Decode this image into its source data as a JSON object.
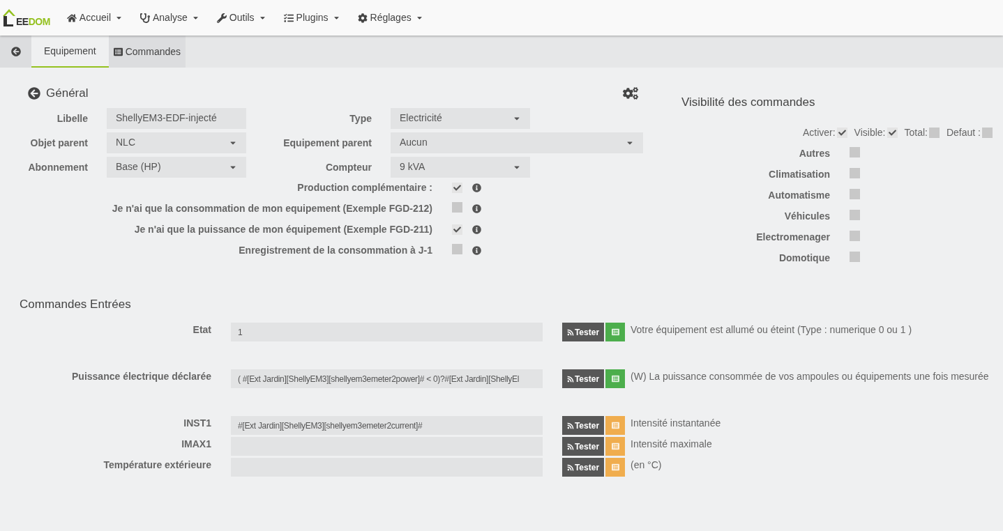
{
  "navbar": {
    "logo_text": "EEDOM",
    "menus": [
      {
        "kind": "home",
        "label": "Accueil"
      },
      {
        "kind": "analysis",
        "label": "Analyse"
      },
      {
        "kind": "tools",
        "label": "Outils"
      },
      {
        "kind": "plugins",
        "label": "Plugins"
      },
      {
        "kind": "settings",
        "label": "Réglages"
      }
    ]
  },
  "tabs": [
    {
      "kind": "text",
      "label": "Equipement",
      "selected": true
    },
    {
      "kind": "list",
      "label": "Commandes",
      "selected": false
    }
  ],
  "general": {
    "title": "Général",
    "fields": [
      {
        "label": "Libelle",
        "value": "ShellyEM3-EDF-injecté",
        "kind": "text"
      },
      {
        "label": "Type",
        "value": "Electricité",
        "kind": "select"
      },
      {
        "label": "Objet parent",
        "value": "NLC",
        "kind": "select"
      },
      {
        "label": "Equipement parent",
        "value": "Aucun",
        "kind": "wide_select"
      },
      {
        "label": "Abonnement",
        "value": "Base (HP)",
        "kind": "select"
      },
      {
        "label": "Compteur",
        "value": "9 kVA",
        "kind": "select"
      }
    ],
    "options": [
      {
        "label": "Production complémentaire :",
        "checked": true
      },
      {
        "label": "Je n'ai que la consommation de mon equipement (Exemple FGD-212)",
        "checked": false
      },
      {
        "label": "Je n'ai que la puissance de mon équipement (Exemple FGD-211)",
        "checked": true
      },
      {
        "label": "Enregistrement de la consommation à J-1",
        "checked": false
      }
    ]
  },
  "visibility": {
    "title": "Visibilité des commandes",
    "toggles": [
      {
        "label": "Activer:",
        "checked": true
      },
      {
        "label": "Visible:",
        "checked": true
      },
      {
        "label": "Total:",
        "checked": false
      },
      {
        "label": "Defaut :",
        "checked": false
      }
    ],
    "categories": [
      {
        "label": "Autres",
        "checked": false
      },
      {
        "label": "Climatisation",
        "checked": false
      },
      {
        "label": "Automatisme",
        "checked": false
      },
      {
        "label": "Véhicules",
        "checked": false
      },
      {
        "label": "Electromenager",
        "checked": false
      },
      {
        "label": "Domotique",
        "checked": false
      }
    ]
  },
  "commands": {
    "title": "Commandes Entrées",
    "groups": [
      [
        {
          "label": "Etat",
          "value": "1",
          "button": "Tester",
          "color": "#4cae4c",
          "description": "Votre équipement est allumé ou éteint (Type : numerique 0 ou 1 )"
        }
      ],
      [
        {
          "label": "Puissance électrique déclarée",
          "value": "( #[Ext Jardin][ShellyEM3][shellyem3emeter2power]# < 0)?#[Ext Jardin][ShellyEl",
          "button": "Tester",
          "color": "#4cae4c",
          "description": "(W) La puissance consommée de vos ampoules ou équipements une fois mesurée"
        }
      ],
      [
        {
          "label": "INST1",
          "value": "#[Ext Jardin][ShellyEM3][shellyem3emeter2current]#",
          "button": "Tester",
          "color": "#f0ad4e",
          "description": "Intensité instantanée"
        },
        {
          "label": "IMAX1",
          "button": "Tester",
          "color": "#f0ad4e",
          "description": "Intensité maximale"
        },
        {
          "label": "Température extérieure",
          "button": "Tester",
          "color": "#f0ad4e",
          "description": "(en °C)"
        }
      ]
    ]
  }
}
